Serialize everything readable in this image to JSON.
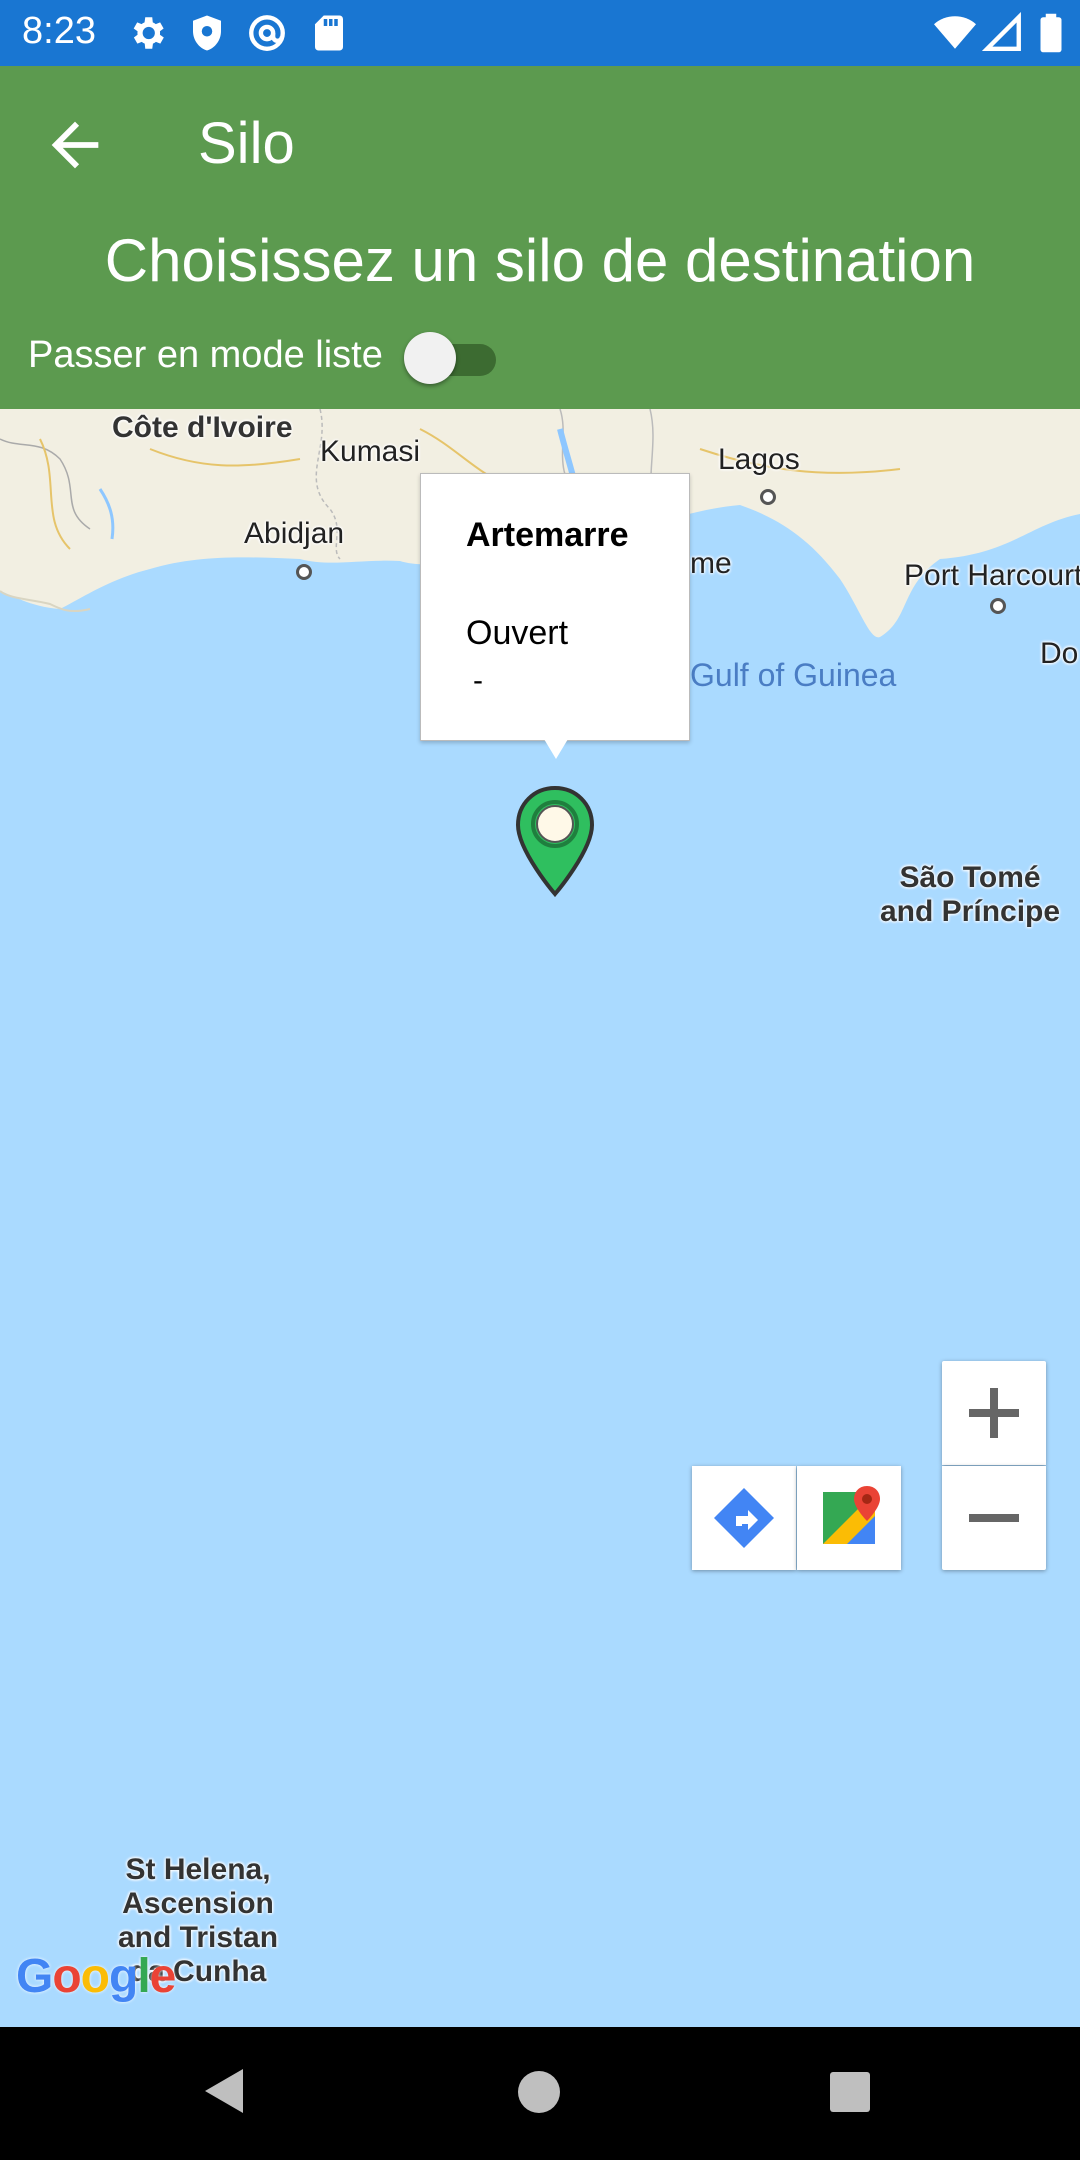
{
  "status_bar": {
    "time": "8:23",
    "icons": [
      "gear-icon",
      "shield-icon",
      "at-sign-icon",
      "sd-card-icon",
      "wifi-icon",
      "signal-icon",
      "battery-icon"
    ]
  },
  "app_bar": {
    "title": "Silo",
    "back_icon": "arrow-left-icon",
    "subtitle": "Choisissez un silo de destination",
    "toggle_label": "Passer en mode liste",
    "toggle_on": false,
    "color": "#5c9a4f"
  },
  "map": {
    "places": {
      "cote_divoire": "Côte d'Ivoire",
      "kumasi": "Kumasi",
      "lagos": "Lagos",
      "abidjan": "Abidjan",
      "lome_partial": "me",
      "port_harcourt": "Port Harcourt",
      "douala_partial": "Do",
      "gulf": "Gulf of Guinea",
      "sao_tome_line1": "São Tomé",
      "sao_tome_line2": "and Príncipe",
      "st_helena_line1": "St Helena,",
      "st_helena_line2": "Ascension",
      "st_helena_line3": "and Tristan",
      "st_helena_line4": "da Cunha"
    },
    "info_window": {
      "title": "Artemarre",
      "status": "Ouvert",
      "extra": "-"
    },
    "marker_color": "#2fbf5f",
    "water_color": "#aadaff",
    "land_color": "#f3f1e4",
    "attribution": "Google"
  },
  "controls": {
    "zoom_in": "+",
    "zoom_out": "−",
    "directions_icon": "directions-icon",
    "google_maps_icon": "google-maps-icon"
  },
  "nav_bar": {
    "icons": [
      "nav-back-icon",
      "nav-home-icon",
      "nav-recents-icon"
    ]
  }
}
